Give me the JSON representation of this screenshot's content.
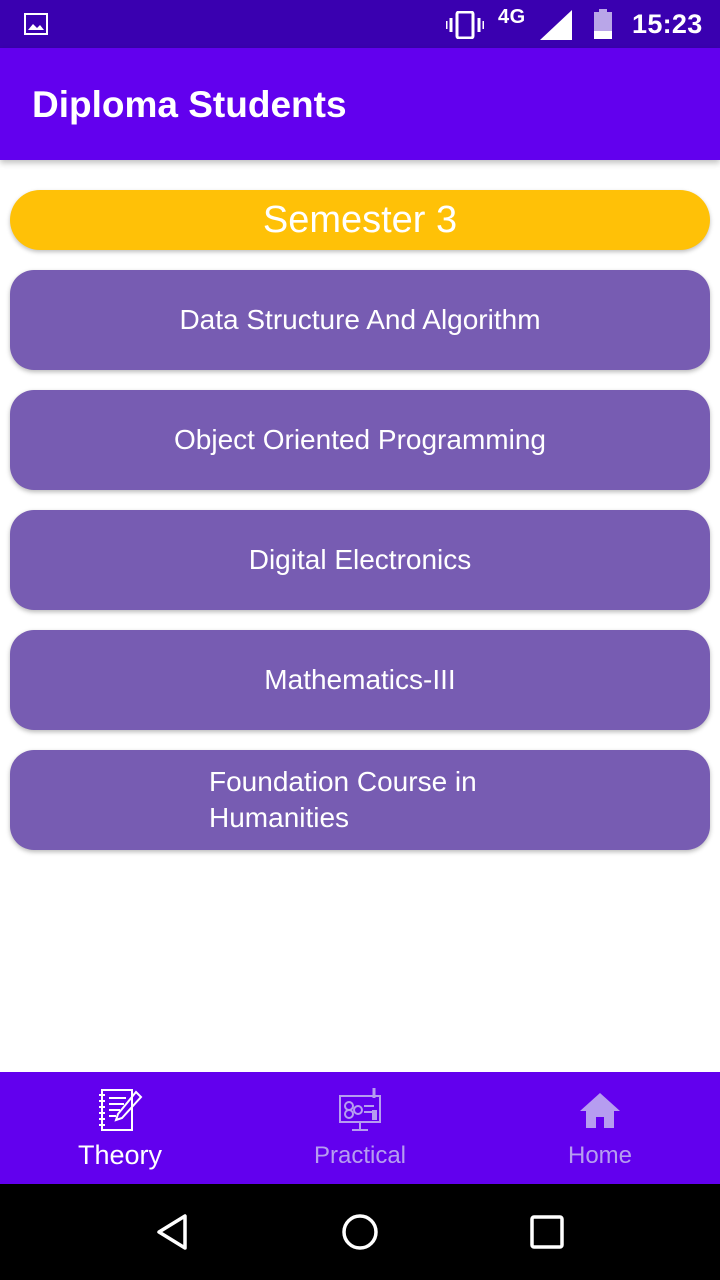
{
  "status_bar": {
    "network": "4G",
    "time": "15:23"
  },
  "app_bar": {
    "title": "Diploma Students"
  },
  "semester": {
    "label": "Semester 3",
    "color": "#ffc107"
  },
  "subjects": [
    {
      "label": "Data Structure And Algorithm"
    },
    {
      "label": "Object Oriented Programming"
    },
    {
      "label": "Digital Electronics"
    },
    {
      "label": "Mathematics-III"
    },
    {
      "label": "Foundation Course in Humanities"
    }
  ],
  "bottom_nav": {
    "items": [
      {
        "label": "Theory",
        "icon": "notebook-pencil-icon",
        "active": true
      },
      {
        "label": "Practical",
        "icon": "presentation-board-icon",
        "active": false
      },
      {
        "label": "Home",
        "icon": "home-icon",
        "active": false
      }
    ]
  },
  "colors": {
    "primary": "#6200ee",
    "status_bar": "#3a00b0",
    "subject_button": "#775cb2",
    "accent": "#ffc107"
  },
  "system_nav": {
    "icons": [
      "back-icon",
      "home-circle-icon",
      "recents-icon"
    ]
  }
}
